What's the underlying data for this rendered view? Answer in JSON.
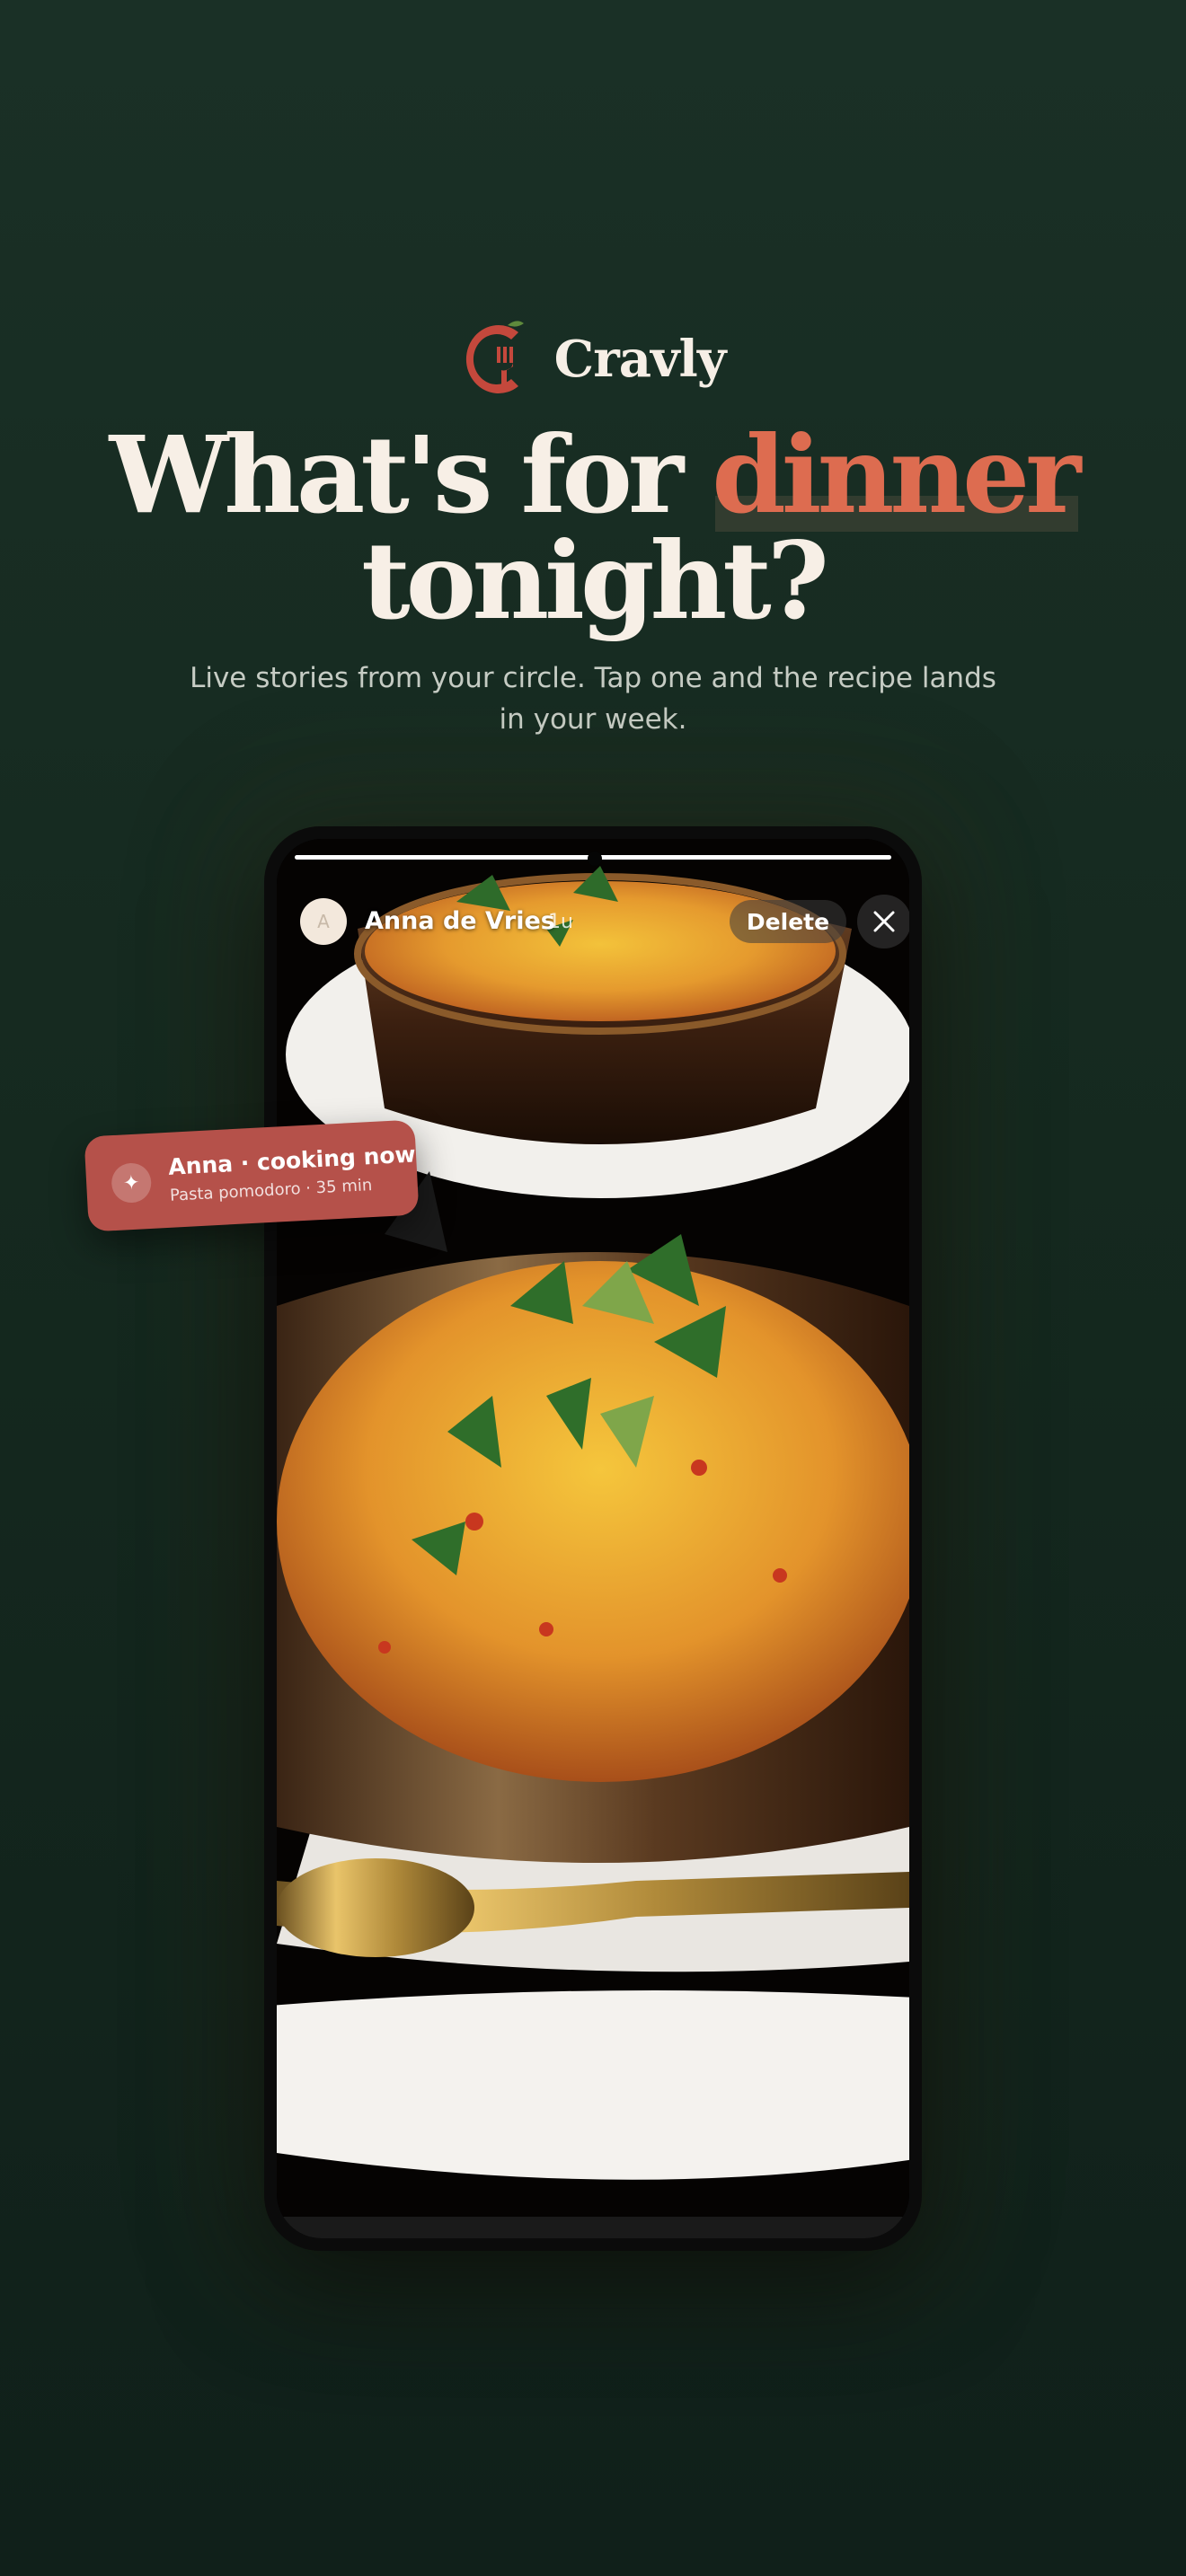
{
  "brand": {
    "name": "Cravly",
    "logo_icon": "fork-c-logo-icon",
    "accent_color": "#dd6c50"
  },
  "hero": {
    "headline_before": "What's for",
    "headline_accent": "dinner",
    "headline_line2": "tonight?",
    "subtitle": "Live stories from your circle. Tap one and the recipe lands in your week."
  },
  "story": {
    "progress": 1.0,
    "avatar_initial": "A",
    "user_name": "Anna de Vries",
    "time_ago": "1u",
    "delete_label": "Delete",
    "close_icon": "close-icon",
    "image_icon": "rice-dish-photo"
  },
  "toast": {
    "icon": "sparkle-icon",
    "title": "Anna · cooking now",
    "subtitle": "Pasta pomodoro · 35 min",
    "color": "#b5514a"
  },
  "colors": {
    "background": "#1a3026",
    "headline": "#f7efe6",
    "subtitle": "#c6ccc4"
  }
}
